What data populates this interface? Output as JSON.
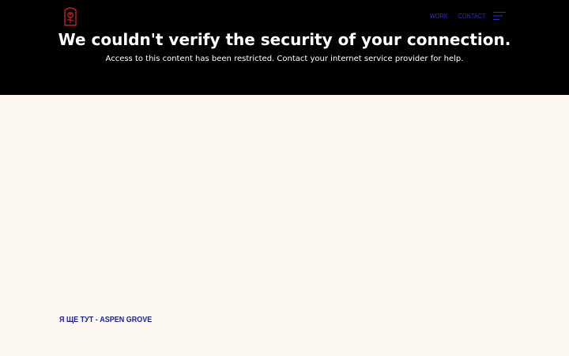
{
  "header": {
    "logo_icon": "rose-emblem-icon",
    "nav": [
      {
        "label": "WORK"
      },
      {
        "label": "CONTACT"
      }
    ],
    "menu_icon": "hamburger-menu-icon"
  },
  "notice": {
    "title": "We couldn't verify the security of your connection.",
    "message": "Access to this content has been restricted. Contact your internet service provider for help."
  },
  "main": {
    "caption": "Я ЩЕ ТУТ - ASPEN GROVE"
  },
  "colors": {
    "band": "#000000",
    "page_background": "#fdf7f1",
    "nav_link": "#2b2fbf",
    "caption": "#1c2499",
    "logo_accent": "#c0202a"
  }
}
